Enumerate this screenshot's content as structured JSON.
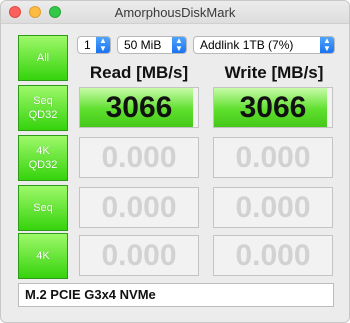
{
  "window": {
    "title": "AmorphousDiskMark"
  },
  "controls": {
    "all_button": "All",
    "count_select": "1",
    "size_select": "50 MiB",
    "drive_select": "Addlink 1TB (7%)"
  },
  "columns": {
    "read": "Read [MB/s]",
    "write": "Write [MB/s]"
  },
  "rows": [
    {
      "label": "Seq\nQD32",
      "read": "3066",
      "write": "3066",
      "read_fill": 0.96,
      "write_fill": 0.96
    },
    {
      "label": "4K\nQD32",
      "read": "0.000",
      "write": "0.000",
      "read_fill": 0,
      "write_fill": 0
    },
    {
      "label": "Seq",
      "read": "0.000",
      "write": "0.000",
      "read_fill": 0,
      "write_fill": 0
    },
    {
      "label": "4K",
      "read": "0.000",
      "write": "0.000",
      "read_fill": 0,
      "write_fill": 0
    }
  ],
  "comment": "M.2 PCIE G3x4 NVMe",
  "colors": {
    "accent_green": "#46c81a",
    "select_blue": "#1a73f0"
  }
}
